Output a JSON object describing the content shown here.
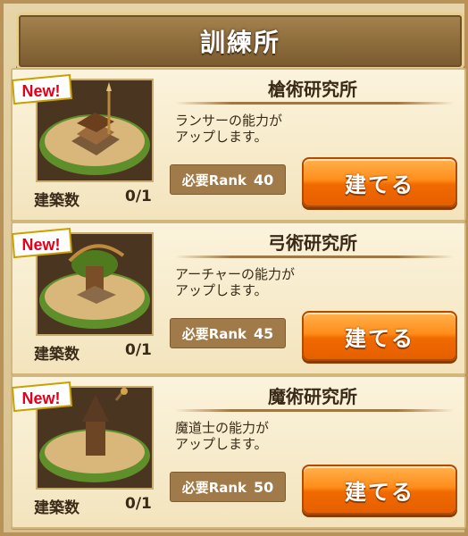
{
  "header": {
    "title": "訓練所"
  },
  "cards": [
    {
      "badge": "New!",
      "name": "槍術研究所",
      "description": "ランサーの能力が\nアップします。",
      "count_label": "建築数",
      "count_value": "0/1",
      "rank_label": "必要Rank",
      "rank_value": "40",
      "button_label": "建てる",
      "icon": "spear-tower-icon"
    },
    {
      "badge": "New!",
      "name": "弓術研究所",
      "description": "アーチャーの能力が\nアップします。",
      "count_label": "建築数",
      "count_value": "0/1",
      "rank_label": "必要Rank",
      "rank_value": "45",
      "button_label": "建てる",
      "icon": "bow-tower-icon"
    },
    {
      "badge": "New!",
      "name": "魔術研究所",
      "description": "魔道士の能力が\nアップします。",
      "count_label": "建築数",
      "count_value": "0/1",
      "rank_label": "必要Rank",
      "rank_value": "50",
      "button_label": "建てる",
      "icon": "magic-tower-icon"
    }
  ],
  "colors": {
    "button": "#ff8d1a",
    "rank_box": "#a07a48",
    "title_bar": "#8a6a3a",
    "card_bg": "#fbf3dc"
  }
}
